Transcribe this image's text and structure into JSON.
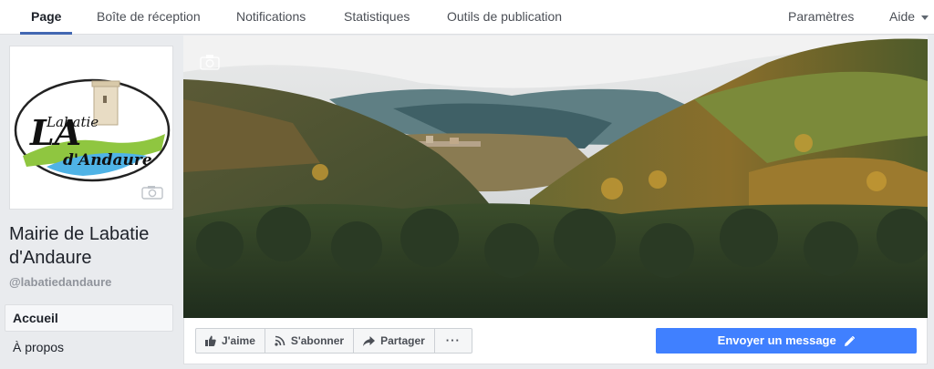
{
  "tabs": [
    {
      "label": "Page",
      "active": true
    },
    {
      "label": "Boîte de réception"
    },
    {
      "label": "Notifications"
    },
    {
      "label": "Statistiques"
    },
    {
      "label": "Outils de publication"
    }
  ],
  "tabs_right": {
    "settings": "Paramètres",
    "help": "Aide"
  },
  "logo": {
    "line1": "Labatie",
    "line2": "d'Andaure",
    "big_letter": "LA"
  },
  "page": {
    "name": "Mairie de Labatie d'Andaure",
    "handle": "@labatiedandaure"
  },
  "nav": [
    {
      "label": "Accueil",
      "active": true
    },
    {
      "label": "À propos"
    }
  ],
  "actions": {
    "like": "J'aime",
    "follow": "S'abonner",
    "share": "Partager",
    "more": "···",
    "send_message": "Envoyer un message"
  },
  "colors": {
    "accent": "#4267b2",
    "message_button": "#4080ff"
  },
  "icons": [
    "camera-icon",
    "like-icon",
    "rss-icon",
    "share-icon",
    "more-icon",
    "pencil-icon",
    "chevron-down-icon"
  ]
}
